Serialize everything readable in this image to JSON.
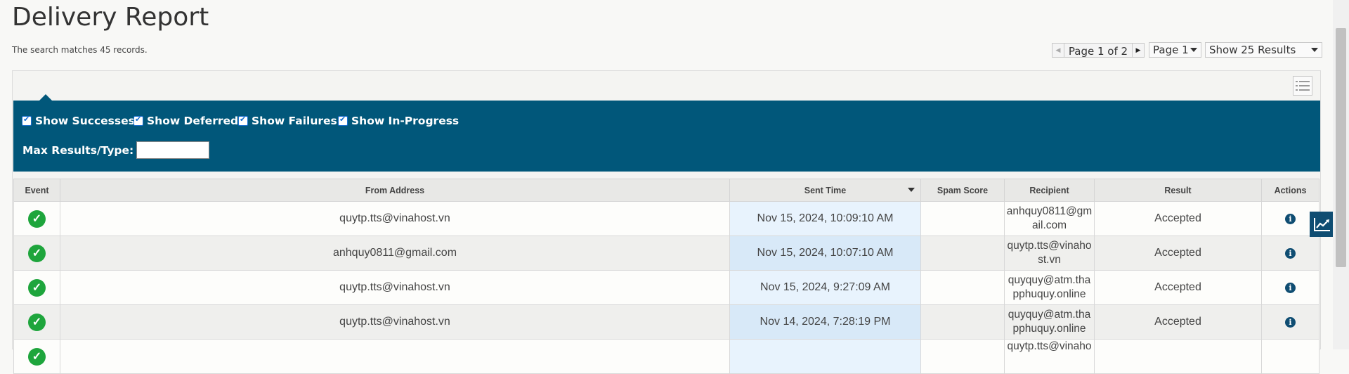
{
  "header": {
    "title": "Delivery Report",
    "match_text": "The search matches 45 records."
  },
  "pagination": {
    "page_text": "Page 1 of 2",
    "page_select": "Page 1",
    "results_select": "Show 25 Results"
  },
  "filters": {
    "show_successes": "Show Successes",
    "show_deferred": "Show Deferred",
    "show_failures": "Show Failures",
    "show_in_progress": "Show In-Progress",
    "max_results_label": "Max Results/Type:",
    "max_results_value": ""
  },
  "table": {
    "columns": [
      "Event",
      "From Address",
      "Sent Time",
      "Spam Score",
      "Recipient",
      "Result",
      "Actions"
    ],
    "rows": [
      {
        "event": "success",
        "from": "quytp.tts@vinahost.vn",
        "sent": "Nov 15, 2024, 10:09:10 AM",
        "spam": "",
        "recipient": "anhquy0811@gmail.com",
        "result": "Accepted"
      },
      {
        "event": "success",
        "from": "anhquy0811@gmail.com",
        "sent": "Nov 15, 2024, 10:07:10 AM",
        "spam": "",
        "recipient": "quytp.tts@vinahost.vn",
        "result": "Accepted"
      },
      {
        "event": "success",
        "from": "quytp.tts@vinahost.vn",
        "sent": "Nov 15, 2024, 9:27:09 AM",
        "spam": "",
        "recipient": "quyquy@atm.thapphuquy.online",
        "result": "Accepted"
      },
      {
        "event": "success",
        "from": "quytp.tts@vinahost.vn",
        "sent": "Nov 14, 2024, 7:28:19 PM",
        "spam": "",
        "recipient": "quyquy@atm.thapphuquy.online",
        "result": "Accepted"
      },
      {
        "event": "success",
        "from": "",
        "sent": "",
        "spam": "",
        "recipient": "quytp.tts@vinaho",
        "result": ""
      }
    ]
  },
  "colors": {
    "filter_bar": "#01577a",
    "success_icon": "#1ea53c",
    "info_icon": "#0f4d72",
    "sent_column_highlight": "#e8f3fd"
  }
}
